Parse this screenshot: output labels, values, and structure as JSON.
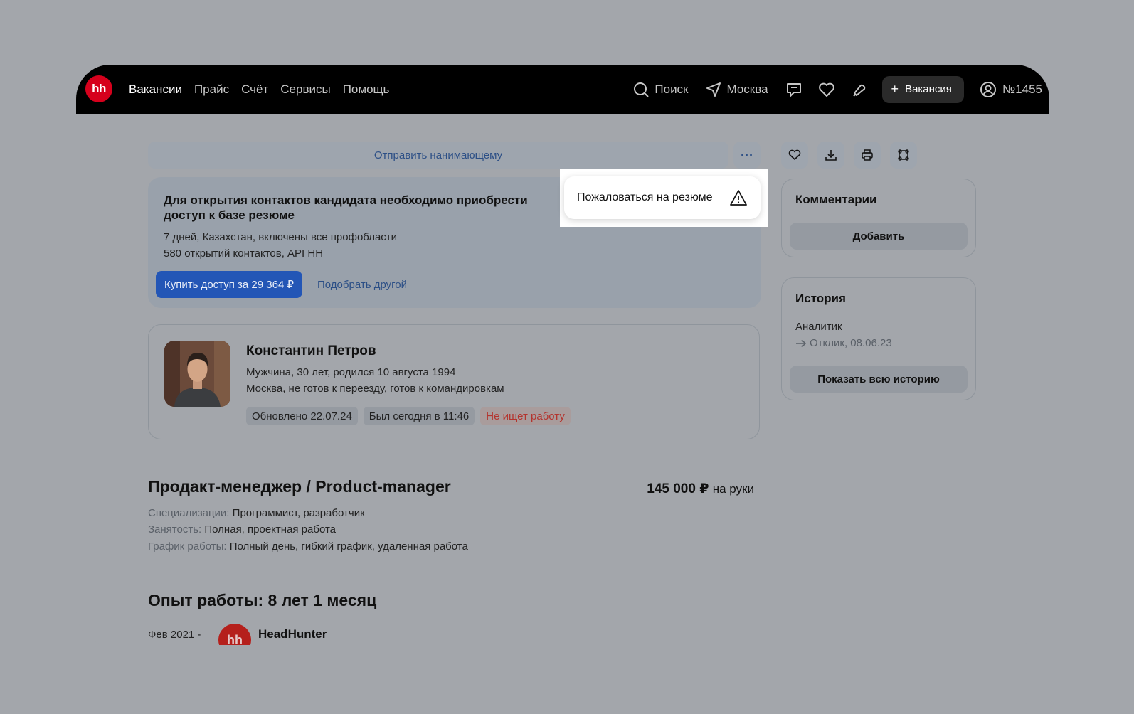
{
  "header": {
    "logo": "hh",
    "nav": [
      "Вакансии",
      "Прайс",
      "Счёт",
      "Сервисы",
      "Помощь"
    ],
    "search_label": "Поиск",
    "city_label": "Москва",
    "vacancy_button": "Вакансия",
    "account_label": "№1455"
  },
  "actions": {
    "send_label": "Отправить нанимающему",
    "more_label": "···"
  },
  "popup": {
    "label": "Пожаловаться на резюме"
  },
  "access": {
    "title": "Для открытия контактов кандидата необходимо приобрести доступ к базе резюме",
    "line1": "7 дней, Казахстан, включены все профобласти",
    "line2": "580 открытий контактов, API HH",
    "buy_label": "Купить доступ за 29 364 ₽",
    "pick_label": "Подобрать другой"
  },
  "profile": {
    "name": "Константин Петров",
    "line1": "Мужчина, 30 лет, родился 10 августа 1994",
    "line2": "Москва, не готов к переезду, готов к командировкам",
    "badges": {
      "updated": "Обновлено 22.07.24",
      "seen": "Был сегодня в 11:46",
      "status": "Не ищет работу"
    }
  },
  "job": {
    "title": "Продакт-менеджер / Product-manager",
    "salary": "145 000 ₽",
    "salary_unit": "на руки",
    "spec_key": "Специализации:",
    "spec_val": "Программист, разработчик",
    "employment_key": "Занятость:",
    "employment_val": "Полная, проектная работа",
    "schedule_key": "График работы:",
    "schedule_val": "Полный день, гибкий график, удаленная работа"
  },
  "experience": {
    "title": "Опыт работы: 8 лет 1 месяц",
    "date": "Фев 2021 -",
    "logo": "hh",
    "company": "HeadHunter"
  },
  "sidebar": {
    "comments_title": "Комментарии",
    "comments_add": "Добавить",
    "history_title": "История",
    "history_item": "Аналитик",
    "history_sub": "Отклик, 08.06.23",
    "history_button": "Показать всю историю"
  }
}
